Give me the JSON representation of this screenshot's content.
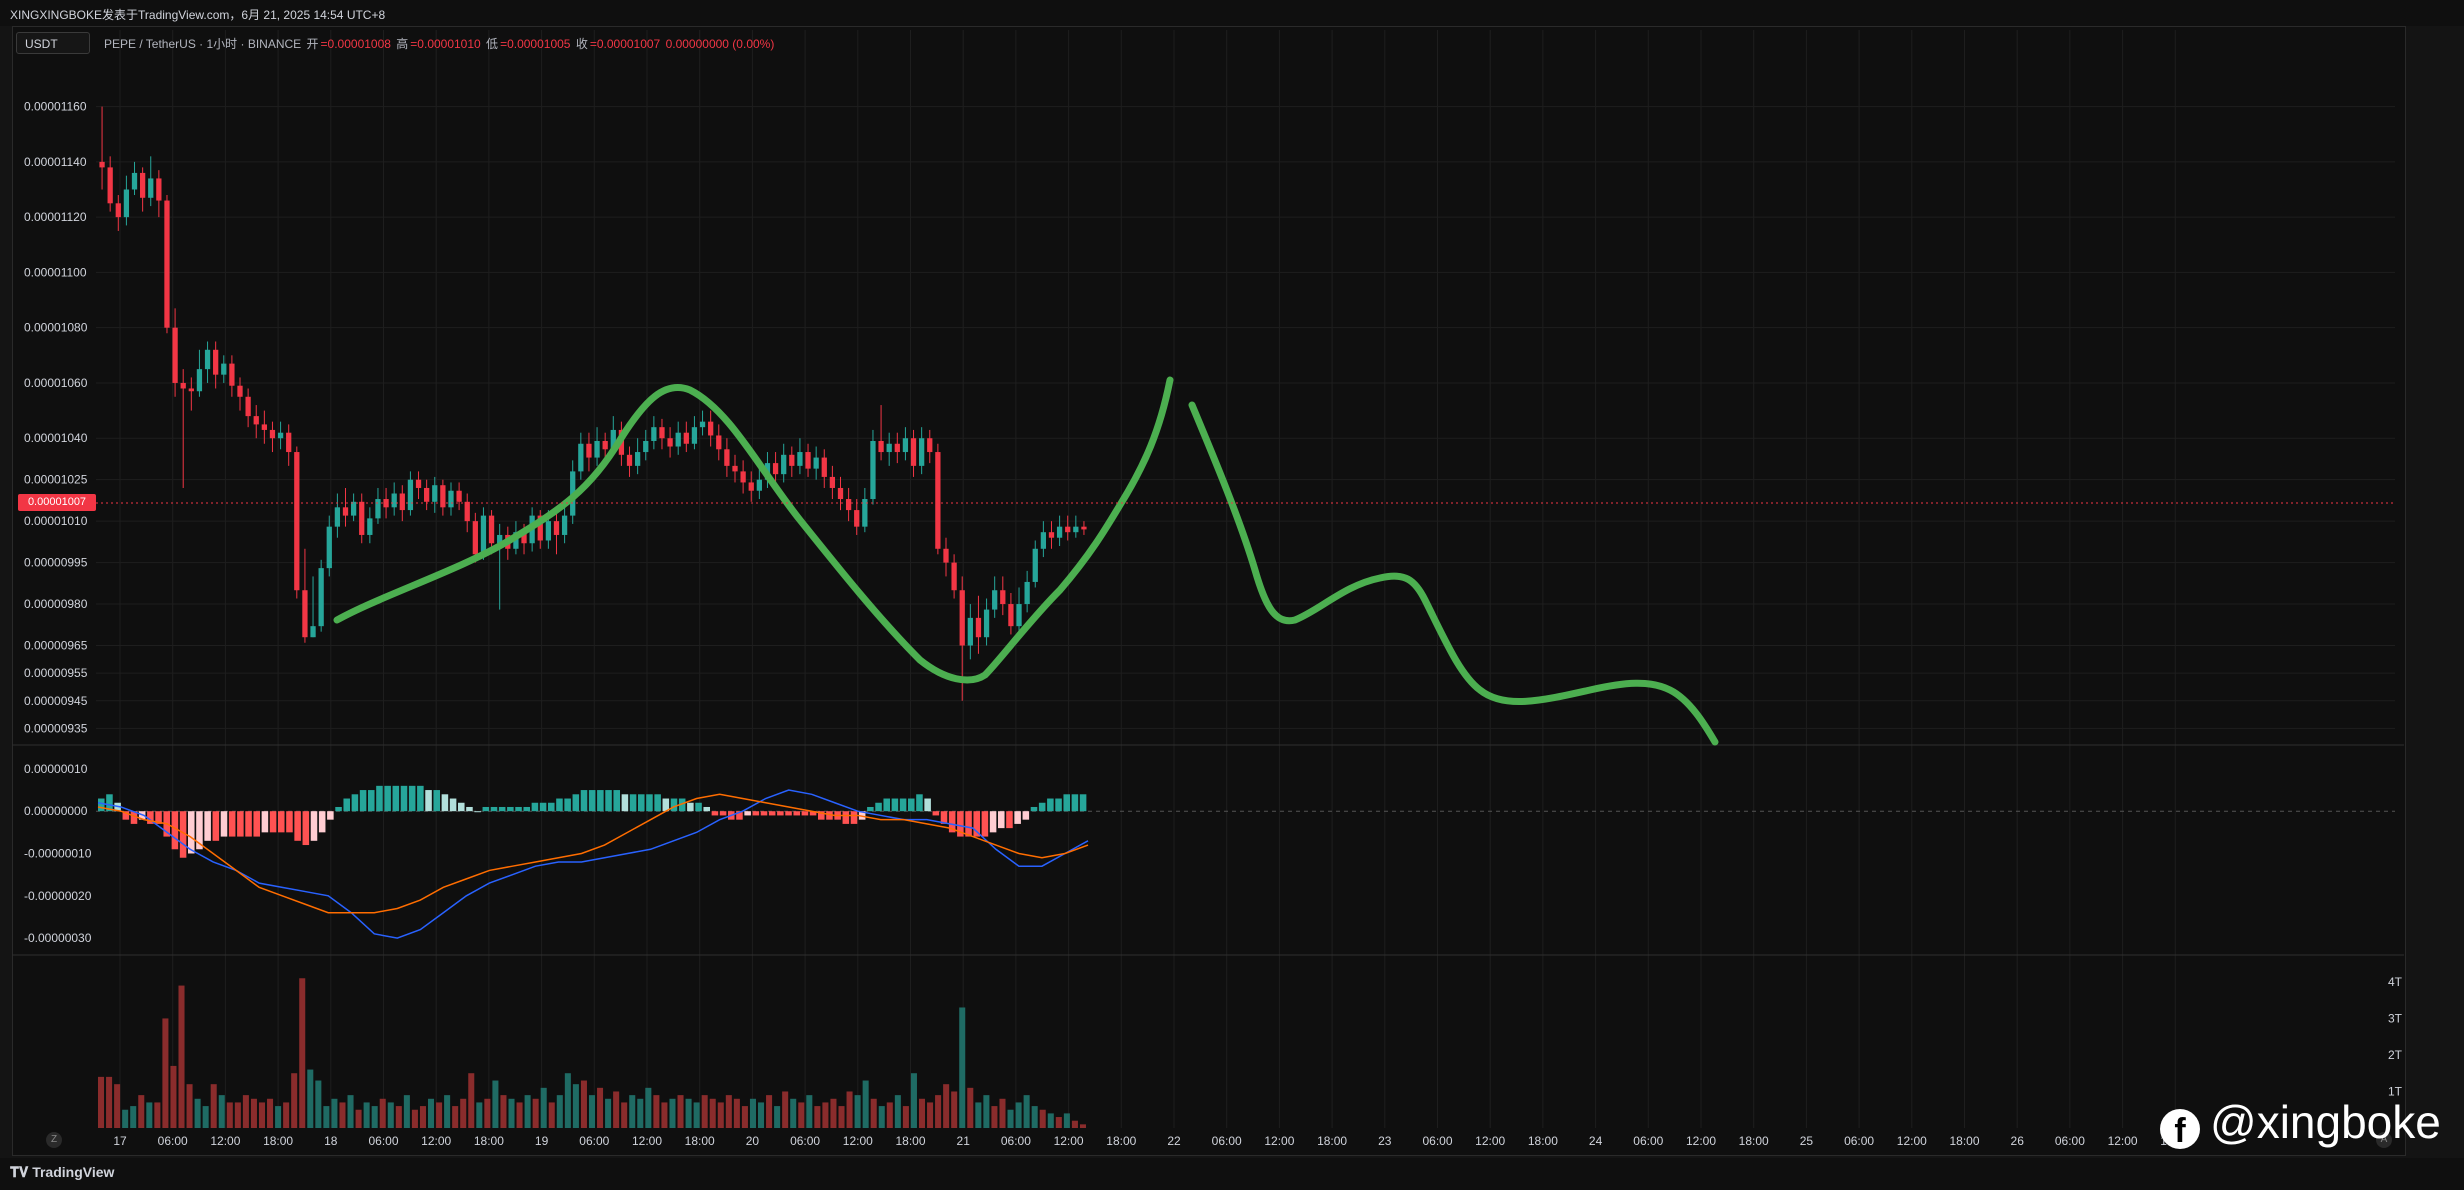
{
  "header": {
    "title": "XINGXINGBOKE发表于TradingView.com，6月 21, 2025 14:54 UTC+8"
  },
  "symbol_box": "USDT",
  "legend": {
    "pair": "PEPE / TetherUS · 1小时 · BINANCE",
    "open_label": "开",
    "open": "=0.00001008",
    "high_label": "高",
    "high": "=0.00001010",
    "low_label": "低",
    "low": "=0.00001005",
    "close_label": "收",
    "close": "=0.00001007",
    "change": "0.00000000 (0.00%)"
  },
  "price_axis": [
    "0.00001160",
    "0.00001140",
    "0.00001120",
    "0.00001100",
    "0.00001080",
    "0.00001060",
    "0.00001040",
    "0.00001025",
    "0.00001010",
    "0.00000995",
    "0.00000980",
    "0.00000965",
    "0.00000955",
    "0.00000945",
    "0.00000935"
  ],
  "current_price": "0.00001007",
  "macd_axis": [
    "0.00000010",
    "0.00000000",
    "-0.00000010",
    "-0.00000020",
    "-0.00000030"
  ],
  "volume_axis": [
    "4T",
    "3T",
    "2T",
    "1T"
  ],
  "time_axis": [
    "17",
    "06:00",
    "12:00",
    "18:00",
    "18",
    "06:00",
    "12:00",
    "18:00",
    "19",
    "06:00",
    "12:00",
    "18:00",
    "20",
    "06:00",
    "12:00",
    "18:00",
    "21",
    "06:00",
    "12:00",
    "18:00",
    "22",
    "06:00",
    "12:00",
    "18:00",
    "23",
    "06:00",
    "12:00",
    "18:00",
    "24",
    "06:00",
    "12:00",
    "18:00",
    "25",
    "06:00",
    "12:00",
    "18:00",
    "26",
    "06:00",
    "12:00",
    "18:00"
  ],
  "footer": {
    "brand": "TradingView",
    "zoom_btn": "Z",
    "auto_btn": "A"
  },
  "watermark": {
    "fb": "f",
    "handle": "@xingboke"
  },
  "colors": {
    "up": "#26a69a",
    "down": "#f23645",
    "projection": "#4caf50",
    "macd": "#2962ff",
    "signal": "#ff6d00"
  },
  "chart_data": {
    "type": "candlestick",
    "price_ylim": [
      9.3e-06,
      1.168e-05
    ],
    "candles": [
      [
        1.14,
        1.138,
        1.16,
        1.13
      ],
      [
        1.138,
        1.125,
        1.142,
        1.122
      ],
      [
        1.125,
        1.12,
        1.128,
        1.115
      ],
      [
        1.12,
        1.13,
        1.135,
        1.117
      ],
      [
        1.13,
        1.136,
        1.14,
        1.128
      ],
      [
        1.136,
        1.127,
        1.138,
        1.122
      ],
      [
        1.127,
        1.134,
        1.142,
        1.124
      ],
      [
        1.134,
        1.126,
        1.137,
        1.12
      ],
      [
        1.126,
        1.08,
        1.128,
        1.078
      ],
      [
        1.08,
        1.06,
        1.087,
        1.055
      ],
      [
        1.06,
        1.058,
        1.065,
        1.022
      ],
      [
        1.058,
        1.057,
        1.062,
        1.05
      ],
      [
        1.057,
        1.065,
        1.072,
        1.055
      ],
      [
        1.065,
        1.072,
        1.075,
        1.06
      ],
      [
        1.072,
        1.063,
        1.075,
        1.058
      ],
      [
        1.063,
        1.067,
        1.07,
        1.06
      ],
      [
        1.067,
        1.059,
        1.07,
        1.055
      ],
      [
        1.059,
        1.055,
        1.062,
        1.05
      ],
      [
        1.055,
        1.048,
        1.058,
        1.044
      ],
      [
        1.048,
        1.045,
        1.052,
        1.04
      ],
      [
        1.045,
        1.043,
        1.05,
        1.038
      ],
      [
        1.043,
        1.04,
        1.046,
        1.035
      ],
      [
        1.04,
        1.042,
        1.046,
        1.036
      ],
      [
        1.042,
        1.035,
        1.045,
        1.03
      ],
      [
        1.035,
        0.985,
        1.037,
        0.982
      ],
      [
        0.985,
        0.968,
        1.0,
        0.966
      ],
      [
        0.968,
        0.972,
        0.99,
        0.968
      ],
      [
        0.972,
        0.993,
        0.996,
        0.97
      ],
      [
        0.993,
        1.008,
        1.012,
        0.99
      ],
      [
        1.008,
        1.015,
        1.02,
        1.004
      ],
      [
        1.015,
        1.012,
        1.022,
        1.008
      ],
      [
        1.012,
        1.017,
        1.02,
        1.01
      ],
      [
        1.017,
        1.005,
        1.02,
        1.002
      ],
      [
        1.005,
        1.011,
        1.015,
        1.002
      ],
      [
        1.011,
        1.018,
        1.022,
        1.009
      ],
      [
        1.018,
        1.015,
        1.022,
        1.011
      ],
      [
        1.015,
        1.02,
        1.024,
        1.012
      ],
      [
        1.02,
        1.014,
        1.023,
        1.01
      ],
      [
        1.014,
        1.025,
        1.028,
        1.012
      ],
      [
        1.025,
        1.022,
        1.028,
        1.018
      ],
      [
        1.022,
        1.017,
        1.025,
        1.014
      ],
      [
        1.017,
        1.023,
        1.026,
        1.013
      ],
      [
        1.023,
        1.015,
        1.025,
        1.012
      ],
      [
        1.015,
        1.021,
        1.024,
        1.012
      ],
      [
        1.021,
        1.017,
        1.024,
        1.014
      ],
      [
        1.017,
        1.01,
        1.02,
        1.006
      ],
      [
        1.01,
        0.998,
        1.013,
        0.995
      ],
      [
        0.998,
        1.012,
        1.015,
        0.996
      ],
      [
        1.012,
        1.002,
        1.014,
        0.998
      ],
      [
        1.002,
        1.005,
        1.009,
        0.978
      ],
      [
        1.005,
        1.0,
        1.008,
        0.996
      ],
      [
        1.0,
        1.006,
        1.01,
        0.998
      ],
      [
        1.006,
        1.002,
        1.009,
        0.998
      ],
      [
        1.002,
        1.012,
        1.015,
        0.999
      ],
      [
        1.012,
        1.003,
        1.014,
        1.0
      ],
      [
        1.003,
        1.01,
        1.014,
        1.0
      ],
      [
        1.01,
        1.005,
        1.013,
        0.998
      ],
      [
        1.005,
        1.012,
        1.016,
        1.002
      ],
      [
        1.012,
        1.028,
        1.032,
        1.009
      ],
      [
        1.028,
        1.038,
        1.042,
        1.025
      ],
      [
        1.038,
        1.033,
        1.042,
        1.028
      ],
      [
        1.033,
        1.039,
        1.044,
        1.03
      ],
      [
        1.039,
        1.036,
        1.042,
        1.032
      ],
      [
        1.036,
        1.043,
        1.048,
        1.034
      ],
      [
        1.043,
        1.034,
        1.046,
        1.03
      ],
      [
        1.034,
        1.03,
        1.037,
        1.026
      ],
      [
        1.03,
        1.035,
        1.04,
        1.027
      ],
      [
        1.035,
        1.039,
        1.043,
        1.032
      ],
      [
        1.039,
        1.044,
        1.048,
        1.036
      ],
      [
        1.044,
        1.04,
        1.047,
        1.036
      ],
      [
        1.04,
        1.037,
        1.044,
        1.033
      ],
      [
        1.037,
        1.042,
        1.046,
        1.034
      ],
      [
        1.042,
        1.038,
        1.046,
        1.035
      ],
      [
        1.038,
        1.044,
        1.048,
        1.036
      ],
      [
        1.044,
        1.046,
        1.05,
        1.041
      ],
      [
        1.046,
        1.041,
        1.05,
        1.037
      ],
      [
        1.041,
        1.036,
        1.045,
        1.032
      ],
      [
        1.036,
        1.03,
        1.04,
        1.026
      ],
      [
        1.03,
        1.028,
        1.034,
        1.024
      ],
      [
        1.028,
        1.024,
        1.032,
        1.02
      ],
      [
        1.024,
        1.021,
        1.028,
        1.017
      ],
      [
        1.021,
        1.025,
        1.03,
        1.018
      ],
      [
        1.025,
        1.031,
        1.035,
        1.022
      ],
      [
        1.031,
        1.027,
        1.035,
        1.023
      ],
      [
        1.027,
        1.034,
        1.038,
        1.024
      ],
      [
        1.034,
        1.03,
        1.037,
        1.026
      ],
      [
        1.03,
        1.035,
        1.04,
        1.027
      ],
      [
        1.035,
        1.029,
        1.038,
        1.026
      ],
      [
        1.029,
        1.033,
        1.037,
        1.025
      ],
      [
        1.033,
        1.026,
        1.036,
        1.022
      ],
      [
        1.026,
        1.022,
        1.03,
        1.018
      ],
      [
        1.022,
        1.018,
        1.026,
        1.014
      ],
      [
        1.018,
        1.014,
        1.022,
        1.01
      ],
      [
        1.014,
        1.008,
        1.018,
        1.005
      ],
      [
        1.008,
        1.018,
        1.022,
        1.006
      ],
      [
        1.018,
        1.039,
        1.043,
        1.016
      ],
      [
        1.039,
        1.035,
        1.052,
        1.032
      ],
      [
        1.035,
        1.038,
        1.042,
        1.03
      ],
      [
        1.038,
        1.035,
        1.042,
        1.031
      ],
      [
        1.035,
        1.04,
        1.044,
        1.032
      ],
      [
        1.04,
        1.03,
        1.043,
        1.026
      ],
      [
        1.03,
        1.04,
        1.044,
        1.027
      ],
      [
        1.04,
        1.035,
        1.043,
        1.031
      ],
      [
        1.035,
        1.0,
        1.038,
        0.998
      ],
      [
        1.0,
        0.995,
        1.004,
        0.99
      ],
      [
        0.995,
        0.985,
        0.998,
        0.982
      ],
      [
        0.985,
        0.965,
        0.99,
        0.945
      ],
      [
        0.965,
        0.975,
        0.98,
        0.96
      ],
      [
        0.975,
        0.968,
        0.983,
        0.962
      ],
      [
        0.968,
        0.978,
        0.982,
        0.965
      ],
      [
        0.978,
        0.985,
        0.99,
        0.975
      ],
      [
        0.985,
        0.98,
        0.99,
        0.976
      ],
      [
        0.98,
        0.972,
        0.984,
        0.969
      ],
      [
        0.972,
        0.98,
        0.986,
        0.968
      ],
      [
        0.98,
        0.988,
        0.992,
        0.977
      ],
      [
        0.988,
        1.0,
        1.003,
        0.986
      ],
      [
        1.0,
        1.006,
        1.01,
        0.997
      ],
      [
        1.006,
        1.004,
        1.01,
        1.0
      ],
      [
        1.004,
        1.008,
        1.012,
        1.001
      ],
      [
        1.008,
        1.006,
        1.012,
        1.003
      ],
      [
        1.006,
        1.008,
        1.012,
        1.004
      ],
      [
        1.008,
        1.007,
        1.01,
        1.005
      ]
    ],
    "volume": [
      1.4,
      1.4,
      1.2,
      0.5,
      0.6,
      0.9,
      0.7,
      0.7,
      3.0,
      1.7,
      3.9,
      1.2,
      0.8,
      0.6,
      1.2,
      0.9,
      0.7,
      0.7,
      0.9,
      0.8,
      0.7,
      0.8,
      0.6,
      0.7,
      1.5,
      4.1,
      1.6,
      1.3,
      0.6,
      0.8,
      0.7,
      0.9,
      0.5,
      0.7,
      0.6,
      0.8,
      0.7,
      0.6,
      0.9,
      0.5,
      0.6,
      0.8,
      0.7,
      0.9,
      0.6,
      0.8,
      1.5,
      0.7,
      0.8,
      1.3,
      0.9,
      0.8,
      0.7,
      0.9,
      0.8,
      1.1,
      0.7,
      0.9,
      1.5,
      1.2,
      1.3,
      0.9,
      1.1,
      0.8,
      1.0,
      0.7,
      0.9,
      0.8,
      1.1,
      0.9,
      0.7,
      0.8,
      0.9,
      0.8,
      0.7,
      0.9,
      0.8,
      0.7,
      0.9,
      0.8,
      0.6,
      0.8,
      0.7,
      0.9,
      0.6,
      1.0,
      0.8,
      0.7,
      0.9,
      0.6,
      0.7,
      0.8,
      0.6,
      1.0,
      0.9,
      1.3,
      0.8,
      0.6,
      0.7,
      0.9,
      0.6,
      1.5,
      0.8,
      0.7,
      0.9,
      1.2,
      1.0,
      3.3,
      1.1,
      0.7,
      0.9,
      0.6,
      0.8,
      0.5,
      0.7,
      0.9,
      0.6,
      0.5,
      0.4,
      0.3,
      0.4,
      0.2,
      0.1
    ],
    "macd_hist": [
      0.3,
      0.4,
      0.2,
      -0.2,
      -0.3,
      -0.2,
      -0.3,
      -0.3,
      -0.6,
      -0.9,
      -1.1,
      -1.0,
      -0.9,
      -0.7,
      -0.7,
      -0.6,
      -0.6,
      -0.6,
      -0.6,
      -0.6,
      -0.5,
      -0.5,
      -0.5,
      -0.5,
      -0.7,
      -0.8,
      -0.7,
      -0.5,
      -0.2,
      0.1,
      0.3,
      0.4,
      0.5,
      0.5,
      0.6,
      0.6,
      0.6,
      0.6,
      0.6,
      0.6,
      0.5,
      0.5,
      0.4,
      0.3,
      0.2,
      0.1,
      0.0,
      0.1,
      0.1,
      0.1,
      0.1,
      0.1,
      0.1,
      0.2,
      0.2,
      0.2,
      0.3,
      0.3,
      0.4,
      0.5,
      0.5,
      0.5,
      0.5,
      0.5,
      0.4,
      0.4,
      0.4,
      0.4,
      0.4,
      0.3,
      0.3,
      0.3,
      0.2,
      0.2,
      0.1,
      -0.1,
      -0.1,
      -0.2,
      -0.2,
      -0.1,
      -0.1,
      -0.1,
      -0.1,
      -0.1,
      -0.1,
      -0.1,
      -0.1,
      -0.1,
      -0.2,
      -0.2,
      -0.2,
      -0.3,
      -0.3,
      -0.2,
      0.1,
      0.2,
      0.3,
      0.3,
      0.3,
      0.3,
      0.4,
      0.3,
      -0.1,
      -0.3,
      -0.5,
      -0.6,
      -0.6,
      -0.6,
      -0.6,
      -0.5,
      -0.4,
      -0.4,
      -0.3,
      -0.2,
      0.1,
      0.2,
      0.3,
      0.3,
      0.4,
      0.4,
      0.4
    ],
    "macd_line": [
      0.2,
      0.1,
      -0.1,
      -0.5,
      -0.9,
      -1.2,
      -1.4,
      -1.7,
      -1.8,
      -1.9,
      -2.0,
      -2.4,
      -2.9,
      -3.0,
      -2.8,
      -2.4,
      -2.0,
      -1.7,
      -1.5,
      -1.3,
      -1.2,
      -1.2,
      -1.1,
      -1.0,
      -0.9,
      -0.7,
      -0.5,
      -0.2,
      0.0,
      0.3,
      0.5,
      0.4,
      0.2,
      0.0,
      -0.1,
      -0.2,
      -0.2,
      -0.3,
      -0.4,
      -0.9,
      -1.3,
      -1.3,
      -1.0,
      -0.7
    ],
    "signal_line": [
      0.1,
      0.0,
      -0.2,
      -0.3,
      -0.6,
      -1.0,
      -1.4,
      -1.8,
      -2.0,
      -2.2,
      -2.4,
      -2.4,
      -2.4,
      -2.3,
      -2.1,
      -1.8,
      -1.6,
      -1.4,
      -1.3,
      -1.2,
      -1.1,
      -1.0,
      -0.8,
      -0.5,
      -0.2,
      0.1,
      0.3,
      0.4,
      0.3,
      0.2,
      0.1,
      0.0,
      -0.1,
      -0.1,
      -0.2,
      -0.2,
      -0.3,
      -0.4,
      -0.6,
      -0.8,
      -1.0,
      -1.1,
      -1.0,
      -0.8
    ]
  }
}
